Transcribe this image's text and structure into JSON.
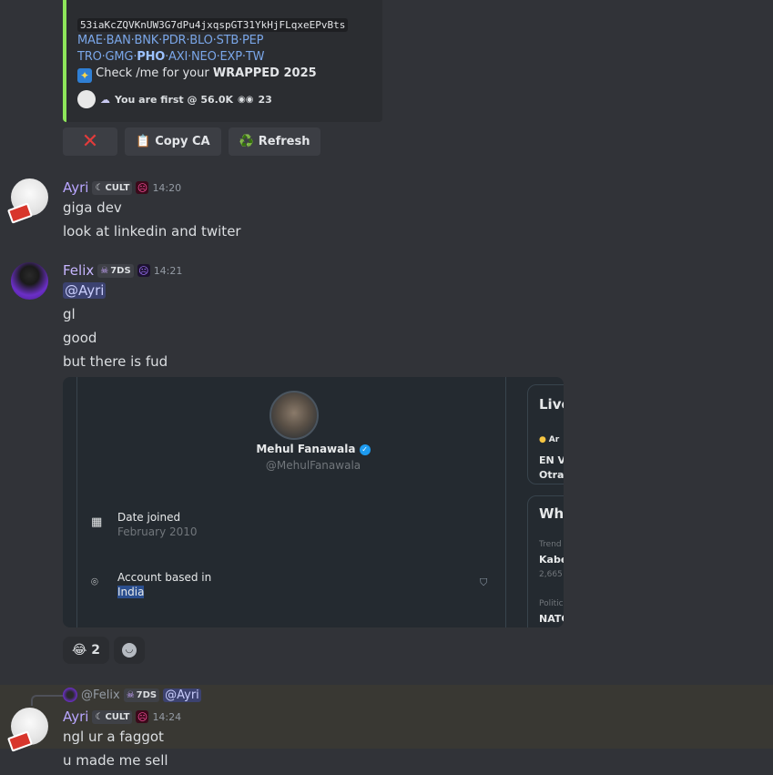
{
  "bot_embed": {
    "contract_address": "53iaKcZQVKnUW3G7dPu4jxqspGT31YkHjFLqxeEPvBts",
    "links_row1": [
      "MAE",
      "BAN",
      "BNK",
      "PDR",
      "BLO",
      "STB",
      "PEP"
    ],
    "links_row2": [
      "TRO",
      "GMG",
      "PHO",
      "AXI",
      "NEO",
      "EXP",
      "TW"
    ],
    "bold_link": "PHO",
    "wrapped_prefix": "Check /me for your ",
    "wrapped_bold": "WRAPPED 2025",
    "footer_text": "You are first @ 56.0K",
    "footer_count": "23",
    "accent_color": "#8ee65a"
  },
  "buttons": {
    "close_icon": "❌",
    "copy_label": "Copy CA",
    "copy_icon": "📋",
    "refresh_label": "Refresh",
    "refresh_icon": "♻️"
  },
  "messages": [
    {
      "author": "Ayri",
      "tag": "CULT",
      "time": "14:20",
      "lines": [
        "giga dev",
        "look at linkedin and twiter"
      ]
    },
    {
      "author": "Felix",
      "tag": "7DS",
      "time": "14:21",
      "mention": "@Ayri",
      "lines": [
        "gl",
        "good",
        "but there is fud"
      ]
    },
    {
      "author": "Ayri",
      "tag": "CULT",
      "time": "14:24",
      "lines": [
        "ngl ur a faggot",
        "u made me sell"
      ]
    }
  ],
  "twitter_card": {
    "name": "Mehul Fanawala",
    "handle": "@MehulFanawala",
    "date_joined_label": "Date joined",
    "date_joined_value": "February 2010",
    "account_based_label": "Account based in",
    "account_based_value": "India",
    "side_live_title": "Live",
    "side_live_small": "Ar",
    "side_live_line1": "EN V",
    "side_live_line2": "Otra",
    "side_what_title": "Wh",
    "side_trend_small": "Trend",
    "side_trend_name": "Kabe",
    "side_trend_count": "2,665",
    "side_politics_small": "Politic",
    "side_politics_name": "NATC"
  },
  "reactions": {
    "emoji": "😂",
    "count": "2",
    "add_reaction_icon": "smiley-add"
  },
  "reply_preview": {
    "author": "@Felix",
    "tag": "7DS",
    "mention": "@Ayri"
  }
}
